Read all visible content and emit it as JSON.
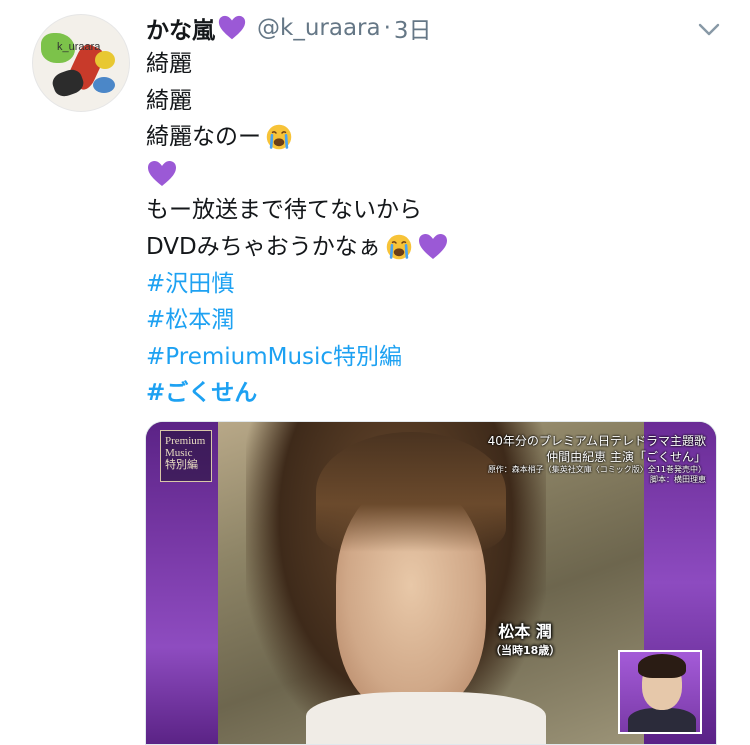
{
  "tweet": {
    "display_name": "かな嵐",
    "handle": "@k_uraara",
    "separator": "·",
    "time": "3日",
    "avatar_text": "k_uraara",
    "lines": [
      "綺麗",
      "綺麗",
      "綺麗なのー",
      "",
      "もー放送まで待てないから",
      "DVDみちゃおうかなぁ"
    ],
    "hashtags": [
      "#沢田慎",
      "#松本潤",
      "#PremiumMusic特別編",
      "#ごくせん"
    ]
  },
  "media": {
    "logo_lines": [
      "Premium",
      "Music",
      "特別編"
    ],
    "caption_lines": [
      "40年分のプレミアム日テレドラマ主題歌",
      "仲間由紀恵 主演「ごくせん」",
      "原作：森本梢子（集英社文庫〈コミック版〉全11巻発売中）",
      "脚本：横田理恵"
    ],
    "name_tag": "松本 潤",
    "name_tag_sub": "（当時18歳）"
  },
  "colors": {
    "hashtag": "#1da1f2",
    "secondary_text": "#657786",
    "heart": "#9b59d6",
    "accent_purple": "#7a3aa8"
  },
  "icons": {
    "heart": "purple-heart-icon",
    "cry": "loudly-crying-face-icon",
    "more": "chevron-down-icon"
  }
}
